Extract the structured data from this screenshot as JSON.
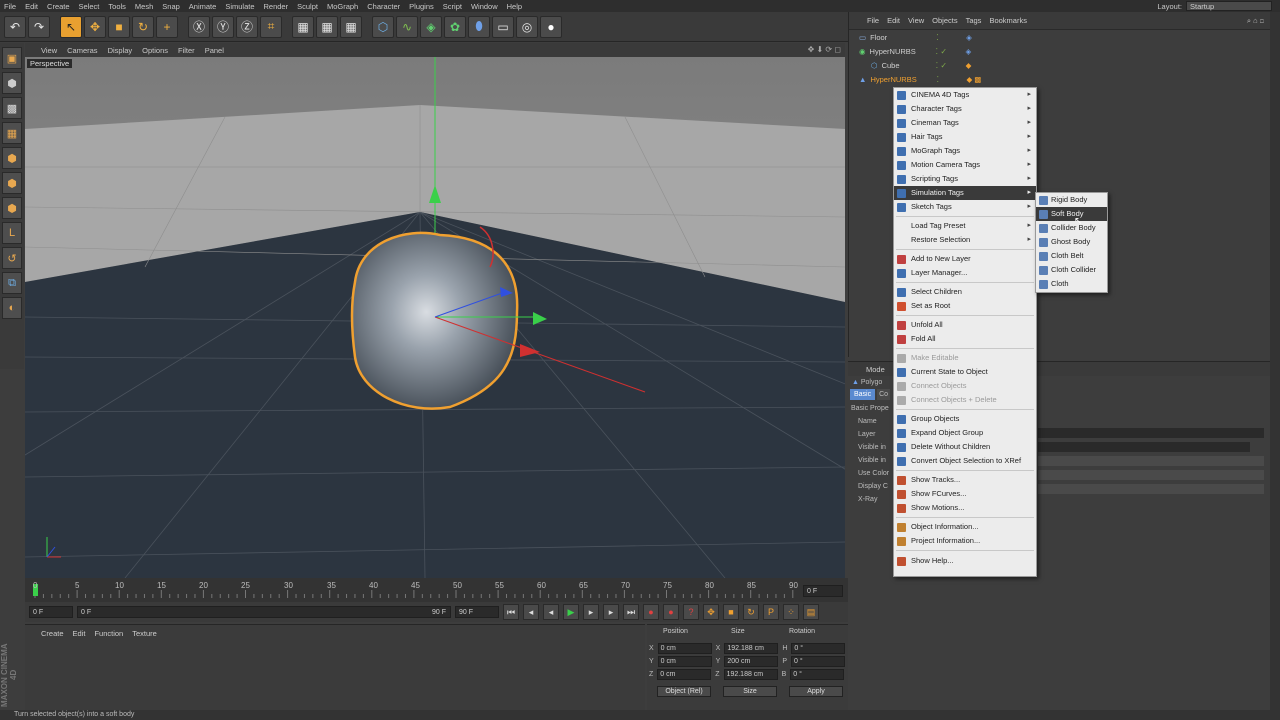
{
  "menubar": {
    "items": [
      "File",
      "Edit",
      "Create",
      "Select",
      "Tools",
      "Mesh",
      "Snap",
      "Animate",
      "Simulate",
      "Render",
      "Sculpt",
      "MoGraph",
      "Character",
      "Plugins",
      "Script",
      "Window",
      "Help"
    ],
    "layout_label": "Layout:",
    "layout_value": "Startup"
  },
  "viewport": {
    "menu": [
      "View",
      "Cameras",
      "Display",
      "Options",
      "Filter",
      "Panel"
    ],
    "label": "Perspective"
  },
  "timeline": {
    "ticks": [
      "0",
      "5",
      "10",
      "15",
      "20",
      "25",
      "30",
      "35",
      "40",
      "45",
      "50",
      "55",
      "60",
      "65",
      "70",
      "75",
      "80",
      "85",
      "90"
    ],
    "current_frame": "0 F",
    "start": "0 F",
    "range_start": "0 F",
    "range_end": "90 F",
    "end": "90 F"
  },
  "material_manager": {
    "menu": [
      "Create",
      "Edit",
      "Function",
      "Texture"
    ]
  },
  "coordinates": {
    "headers": [
      "Position",
      "Size",
      "Rotation"
    ],
    "rows": [
      {
        "axis": "X",
        "pos": "0 cm",
        "saxis": "X",
        "size": "192.188 cm",
        "raxis": "H",
        "rot": "0 °"
      },
      {
        "axis": "Y",
        "pos": "0 cm",
        "saxis": "Y",
        "size": "200 cm",
        "raxis": "P",
        "rot": "0 °"
      },
      {
        "axis": "Z",
        "pos": "0 cm",
        "saxis": "Z",
        "size": "192.188 cm",
        "raxis": "B",
        "rot": "0 °"
      }
    ],
    "mode_select": "Object (Rel)",
    "size_select": "Size",
    "apply": "Apply"
  },
  "brand": "MAXON CINEMA 4D",
  "status_text": "Turn selected object(s) into a soft body",
  "object_manager": {
    "menu": [
      "File",
      "Edit",
      "View",
      "Objects",
      "Tags",
      "Bookmarks"
    ],
    "objects": [
      "Floor",
      "HyperNURBS",
      "Cube",
      "HyperNURBS"
    ]
  },
  "attribute_manager": {
    "mode": "Mode",
    "object_label": "Polygo",
    "tabs": [
      "Basic",
      "Co"
    ],
    "section": "Basic Prope",
    "fields": [
      "Name",
      "Layer",
      "Visible in",
      "Visible in",
      "Use Color",
      "Display C",
      "X-Ray"
    ]
  },
  "context_menu": {
    "items": [
      {
        "label": "CINEMA 4D Tags",
        "arrow": "▸"
      },
      {
        "label": "Character Tags",
        "arrow": "▸"
      },
      {
        "label": "Cineman Tags",
        "arrow": "▸"
      },
      {
        "label": "Hair Tags",
        "arrow": "▸"
      },
      {
        "label": "MoGraph Tags",
        "arrow": "▸"
      },
      {
        "label": "Motion Camera Tags",
        "arrow": "▸"
      },
      {
        "label": "Scripting Tags",
        "arrow": "▸"
      },
      {
        "label": "Simulation Tags",
        "arrow": "▸"
      },
      {
        "label": "Sketch Tags",
        "arrow": "▸"
      },
      {
        "label": "Load Tag Preset",
        "arrow": "▸"
      },
      {
        "label": "Restore Selection",
        "arrow": "▸"
      },
      {
        "label": "Add to New Layer"
      },
      {
        "label": "Layer Manager..."
      },
      {
        "label": "Select Children"
      },
      {
        "label": "Set as Root"
      },
      {
        "label": "Unfold All"
      },
      {
        "label": "Fold All"
      },
      {
        "label": "Make Editable"
      },
      {
        "label": "Current State to Object"
      },
      {
        "label": "Connect Objects"
      },
      {
        "label": "Connect Objects + Delete"
      },
      {
        "label": "Group Objects"
      },
      {
        "label": "Expand Object Group"
      },
      {
        "label": "Delete Without Children"
      },
      {
        "label": "Convert Object Selection to XRef"
      },
      {
        "label": "Show Tracks..."
      },
      {
        "label": "Show FCurves..."
      },
      {
        "label": "Show Motions..."
      },
      {
        "label": "Object Information..."
      },
      {
        "label": "Project Information..."
      },
      {
        "label": "Show Help..."
      }
    ]
  },
  "simulation_submenu": {
    "items": [
      "Rigid Body",
      "Soft Body",
      "Collider Body",
      "Ghost Body",
      "Cloth Belt",
      "Cloth Collider",
      "Cloth"
    ]
  },
  "colors": {
    "accent": "#f0a030",
    "menu_highlight": "#3a3a3a",
    "viewport_floor": "#2c3540"
  }
}
